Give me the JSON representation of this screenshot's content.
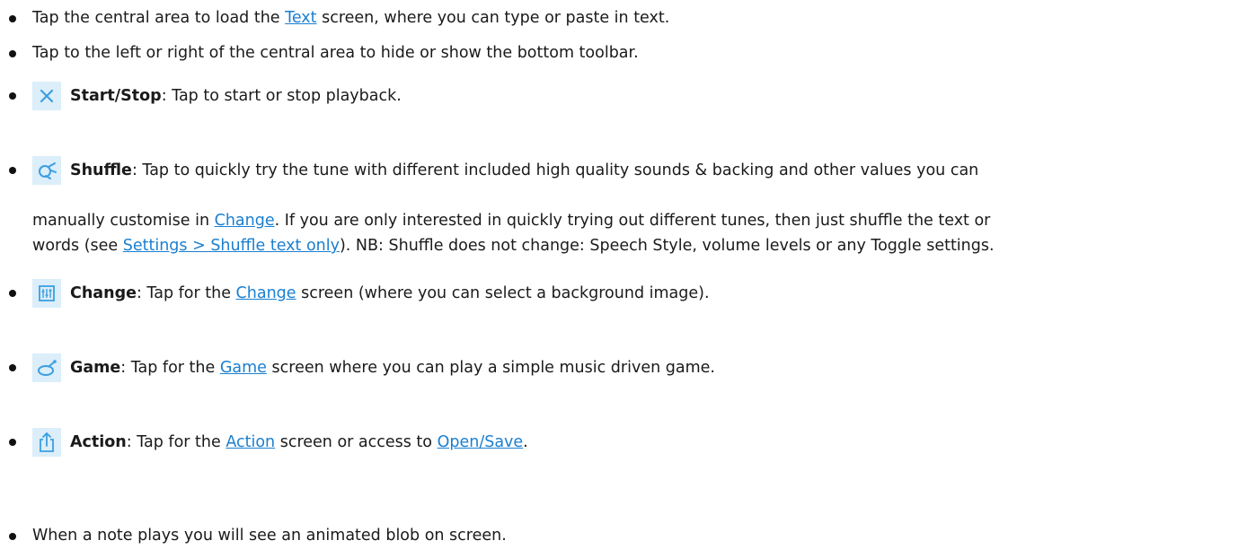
{
  "items": [
    {
      "pre": "Tap the central area to load the ",
      "link": "Text",
      "post": " screen, where you can type or paste in text."
    },
    {
      "text": "Tap to the left or right of the central area to hide or show the bottom toolbar."
    },
    {
      "icon": "close-x-icon",
      "label": "Start/Stop",
      "text": ": Tap to start or stop playback."
    },
    {
      "icon": "shuffle-icon",
      "label": "Shuffle",
      "line1": ": Tap to quickly try the tune with different included high quality sounds & backing and other values you can",
      "line2_pre": "manually customise in ",
      "line2_link": "Change",
      "line2_post": ". If you are only interested in quickly trying out different tunes, then just shuffle the text or",
      "line3_pre": "words (see ",
      "line3_link": "Settings > Shuffle text only",
      "line3_post": "). NB: Shuffle does not change: Speech Style, volume levels or any Toggle settings."
    },
    {
      "icon": "sliders-icon",
      "label": "Change",
      "pre": ": Tap for the ",
      "link": "Change",
      "post": " screen (where you can select a background image)."
    },
    {
      "icon": "game-icon",
      "label": "Game",
      "pre": ": Tap for the ",
      "link": "Game",
      "post": " screen where you can play a simple music driven game."
    },
    {
      "icon": "share-icon",
      "label": "Action",
      "pre": ": Tap for the ",
      "link": "Action",
      "mid": " screen or access to ",
      "link2": "Open/Save",
      "post": "."
    },
    {
      "text": "When a note plays you will see an animated blob on screen."
    }
  ],
  "colors": {
    "link": "#1a7fd0",
    "icon_bg": "#dbeefa",
    "icon_fg": "#3d9ee0"
  }
}
